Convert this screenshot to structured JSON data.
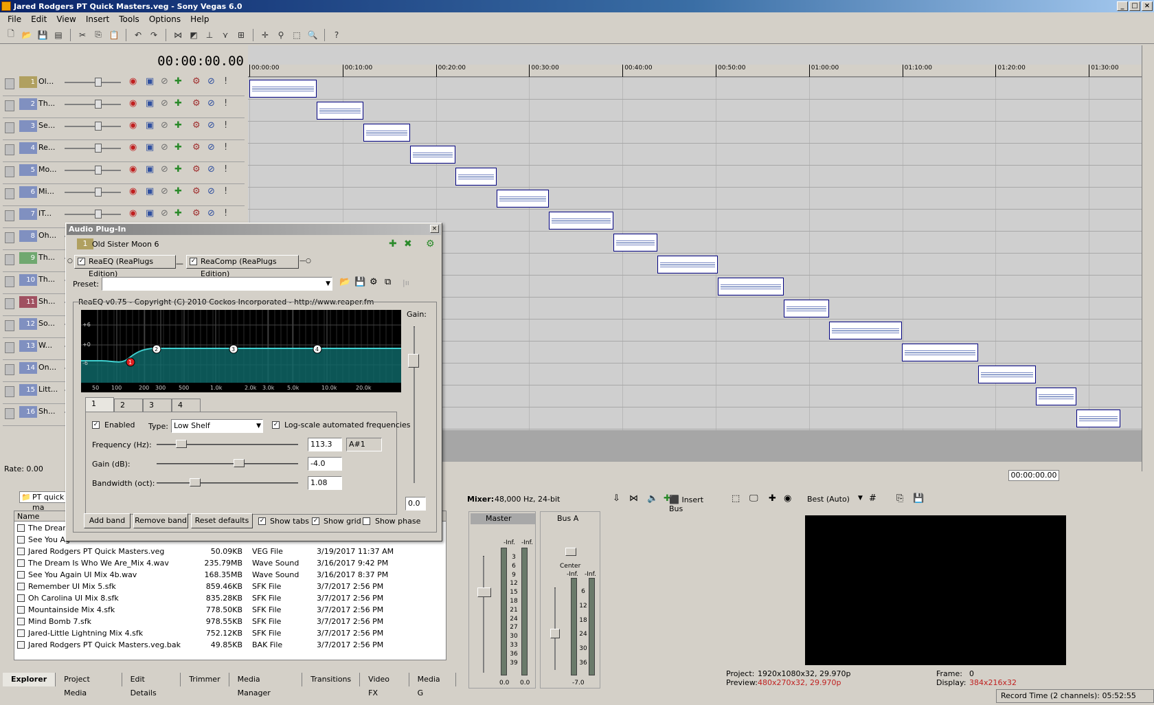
{
  "window": {
    "title": "Jared Rodgers PT Quick Masters.veg - Sony Vegas 6.0"
  },
  "menu": [
    "File",
    "Edit",
    "View",
    "Insert",
    "Tools",
    "Options",
    "Help"
  ],
  "toolbar_icons": [
    "new-icon",
    "open-icon",
    "save-icon",
    "properties-icon",
    "cut-icon",
    "copy-icon",
    "paste-icon",
    "undo-icon",
    "redo-icon",
    "snap-icon",
    "autoripple-icon",
    "lock-icon",
    "crossfade-icon",
    "group-icon",
    "envelope-icon",
    "normal-edit-icon",
    "envelope-edit-icon",
    "selection-edit-icon",
    "zoom-edit-icon",
    "help-icon"
  ],
  "timecode": "00:00:00.00",
  "tracks": [
    {
      "num": "1",
      "name": "Ol...",
      "color": "#b0a060"
    },
    {
      "num": "2",
      "name": "Th...",
      "color": "#8090c0"
    },
    {
      "num": "3",
      "name": "Se...",
      "color": "#8090c0"
    },
    {
      "num": "4",
      "name": "Re...",
      "color": "#8090c0"
    },
    {
      "num": "5",
      "name": "Mo...",
      "color": "#8090c0"
    },
    {
      "num": "6",
      "name": "Mi...",
      "color": "#8090c0"
    },
    {
      "num": "7",
      "name": "IT...",
      "color": "#8090c0"
    },
    {
      "num": "8",
      "name": "Oh...",
      "color": "#8090c0"
    },
    {
      "num": "9",
      "name": "Th...",
      "color": "#70a870"
    },
    {
      "num": "10",
      "name": "Th...",
      "color": "#8090c0"
    },
    {
      "num": "11",
      "name": "Sh...",
      "color": "#a05060"
    },
    {
      "num": "12",
      "name": "So...",
      "color": "#8090c0"
    },
    {
      "num": "13",
      "name": "W...",
      "color": "#8090c0"
    },
    {
      "num": "14",
      "name": "On...",
      "color": "#8090c0"
    },
    {
      "num": "15",
      "name": "Litt...",
      "color": "#8090c0"
    },
    {
      "num": "16",
      "name": "Sh...",
      "color": "#8090c0"
    }
  ],
  "ruler": [
    "00:00:00",
    "00:10:00",
    "00:20:00",
    "00:30:00",
    "00:40:00",
    "00:50:00",
    "01:00:00",
    "01:10:00",
    "01:20:00",
    "01:30:00"
  ],
  "rate": "Rate: 0.00",
  "cursor_timecode": "00:00:00.00",
  "plugin": {
    "title": "Audio Plug-In",
    "track_num": "1",
    "track_name": "Old Sister Moon 6",
    "chain": [
      "ReaEQ (ReaPlugs Edition)",
      "ReaComp (ReaPlugs Edition)"
    ],
    "preset_label": "Preset:",
    "preset_value": "",
    "copyright": "ReaEQ v0.75 - Copyright (C) 2010 Cockos Incorporated - http://www.reaper.fm",
    "db_labels": [
      "+6",
      "+0",
      "-6"
    ],
    "freq_labels": [
      "50",
      "100",
      "200",
      "300",
      "500",
      "1.0k",
      "2.0k",
      "3.0k",
      "5.0k",
      "10.0k",
      "20.0k"
    ],
    "band_points": [
      "1",
      "2",
      "3",
      "4"
    ],
    "gain_label": "Gain:",
    "gain_value": "0.0",
    "tabs": [
      "1",
      "2",
      "3",
      "4"
    ],
    "enabled_label": "Enabled",
    "type_label": "Type:",
    "type_value": "Low Shelf",
    "logscale_label": "Log-scale automated frequencies",
    "freq_label": "Frequency (Hz):",
    "freq_value": "113.3",
    "note_value": "A#1",
    "gain_db_label": "Gain (dB):",
    "gain_db_value": "-4.0",
    "bw_label": "Bandwidth (oct):",
    "bw_value": "1.08",
    "buttons": [
      "Add band",
      "Remove band",
      "Reset defaults"
    ],
    "show_tabs": "Show tabs",
    "show_grid": "Show grid",
    "show_phase": "Show phase"
  },
  "explorer": {
    "path": "PT quick ma",
    "col_name": "Name",
    "files": [
      {
        "name": "The Dream",
        "size": "",
        "type": "",
        "date": ""
      },
      {
        "name": "See You Ag",
        "size": "",
        "type": "",
        "date": ""
      },
      {
        "name": "Jared Rodgers PT Quick Masters.veg",
        "size": "50.09KB",
        "type": "VEG File",
        "date": "3/19/2017 11:37 AM"
      },
      {
        "name": "The Dream Is Who We Are_Mix 4.wav",
        "size": "235.79MB",
        "type": "Wave Sound",
        "date": "3/16/2017 9:42 PM"
      },
      {
        "name": "See You Again UI Mix 4b.wav",
        "size": "168.35MB",
        "type": "Wave Sound",
        "date": "3/16/2017 8:37 PM"
      },
      {
        "name": "Remember UI Mix 5.sfk",
        "size": "859.46KB",
        "type": "SFK File",
        "date": "3/7/2017 2:56 PM"
      },
      {
        "name": "Oh Carolina UI Mix 8.sfk",
        "size": "835.28KB",
        "type": "SFK File",
        "date": "3/7/2017 2:56 PM"
      },
      {
        "name": "Mountainside Mix 4.sfk",
        "size": "778.50KB",
        "type": "SFK File",
        "date": "3/7/2017 2:56 PM"
      },
      {
        "name": "Mind Bomb 7.sfk",
        "size": "978.55KB",
        "type": "SFK File",
        "date": "3/7/2017 2:56 PM"
      },
      {
        "name": "Jared-Little Lightning Mix 4.sfk",
        "size": "752.12KB",
        "type": "SFK File",
        "date": "3/7/2017 2:56 PM"
      },
      {
        "name": "Jared Rodgers PT Quick Masters.veg.bak",
        "size": "49.85KB",
        "type": "BAK File",
        "date": "3/7/2017 2:56 PM"
      }
    ]
  },
  "bottom_tabs": [
    "Explorer",
    "Project Media",
    "Edit Details",
    "Trimmer",
    "Media Manager",
    "Transitions",
    "Video FX",
    "Media G"
  ],
  "mixer": {
    "title": "Mixer:",
    "format": "48,000 Hz, 24-bit",
    "insert_bus": "Insert Bus",
    "master": "Master",
    "bus_a": "Bus A",
    "inf": "-Inf.",
    "center": "Center",
    "master_scale": [
      "3",
      "6",
      "9",
      "12",
      "15",
      "18",
      "21",
      "24",
      "27",
      "30",
      "33",
      "36",
      "39"
    ],
    "bus_scale": [
      "6",
      "12",
      "18",
      "24",
      "30",
      "36"
    ],
    "master_val_l": "0.0",
    "master_val_r": "0.0",
    "bus_val": "-7.0"
  },
  "preview": {
    "quality": "Best (Auto)",
    "project_label": "Project:",
    "project_value": "1920x1080x32, 29.970p",
    "preview_label": "Preview:",
    "preview_value": "480x270x32, 29.970p",
    "frame_label": "Frame:",
    "frame_value": "0",
    "display_label": "Display:",
    "display_value": "384x216x32"
  },
  "status": "Record Time (2 channels): 05:52:55"
}
